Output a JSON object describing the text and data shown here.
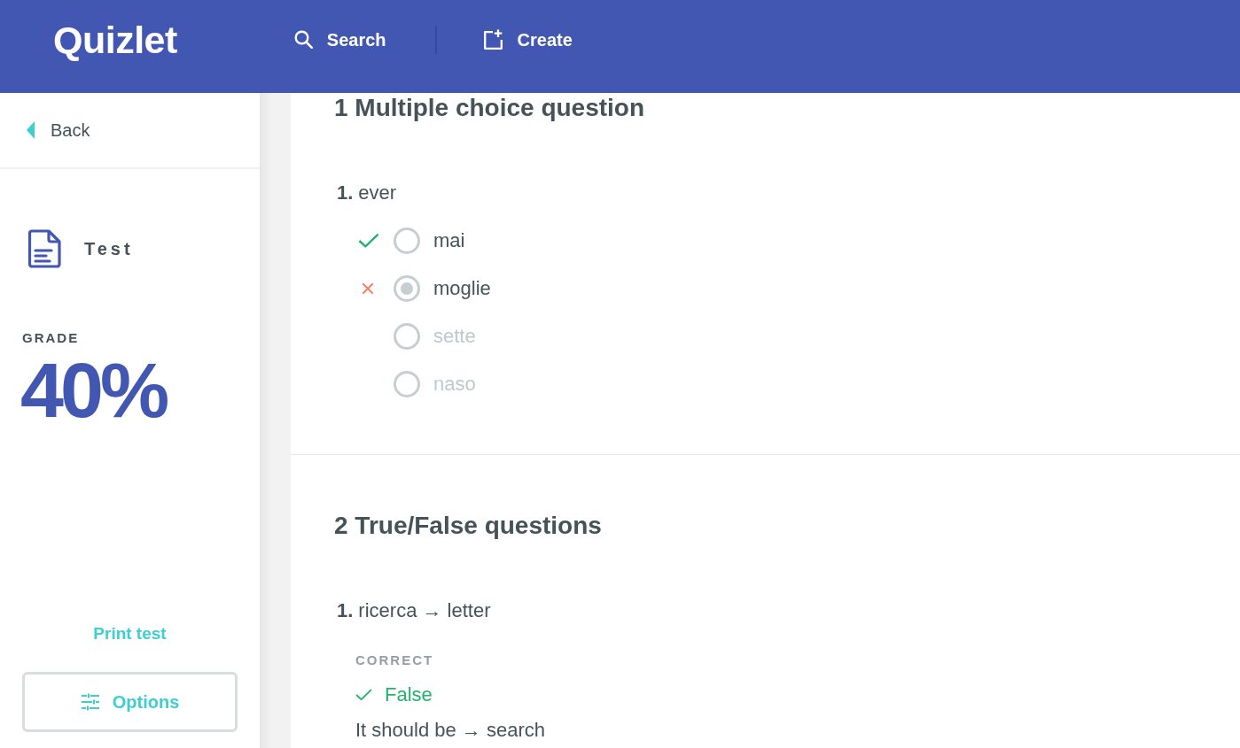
{
  "header": {
    "logo": "Quizlet",
    "nav": [
      {
        "kind": "search",
        "label": "Search"
      },
      {
        "kind": "create",
        "label": "Create"
      }
    ]
  },
  "sidebar": {
    "back": "Back",
    "mode": "Test",
    "grade_label": "GRADE",
    "grade": "40%",
    "print": "Print test",
    "options": "Options"
  },
  "sections": [
    {
      "kind": "multiple_choice",
      "title": "1 Multiple choice question",
      "questions": [
        {
          "number": "1.",
          "prompt": "ever",
          "options": [
            {
              "label": "mai",
              "selected": false,
              "correct": true
            },
            {
              "label": "moglie",
              "selected": true,
              "correct": false
            },
            {
              "label": "sette",
              "selected": false,
              "correct": false
            },
            {
              "label": "naso",
              "selected": false,
              "correct": false
            }
          ]
        }
      ]
    },
    {
      "kind": "true_false",
      "title": "2 True/False questions",
      "questions": [
        {
          "number": "1.",
          "prompt": "ricerca → letter",
          "answer": {
            "label": "CORRECT",
            "correct": true,
            "value": "False",
            "explanation": "It should be → search"
          }
        }
      ]
    }
  ]
}
